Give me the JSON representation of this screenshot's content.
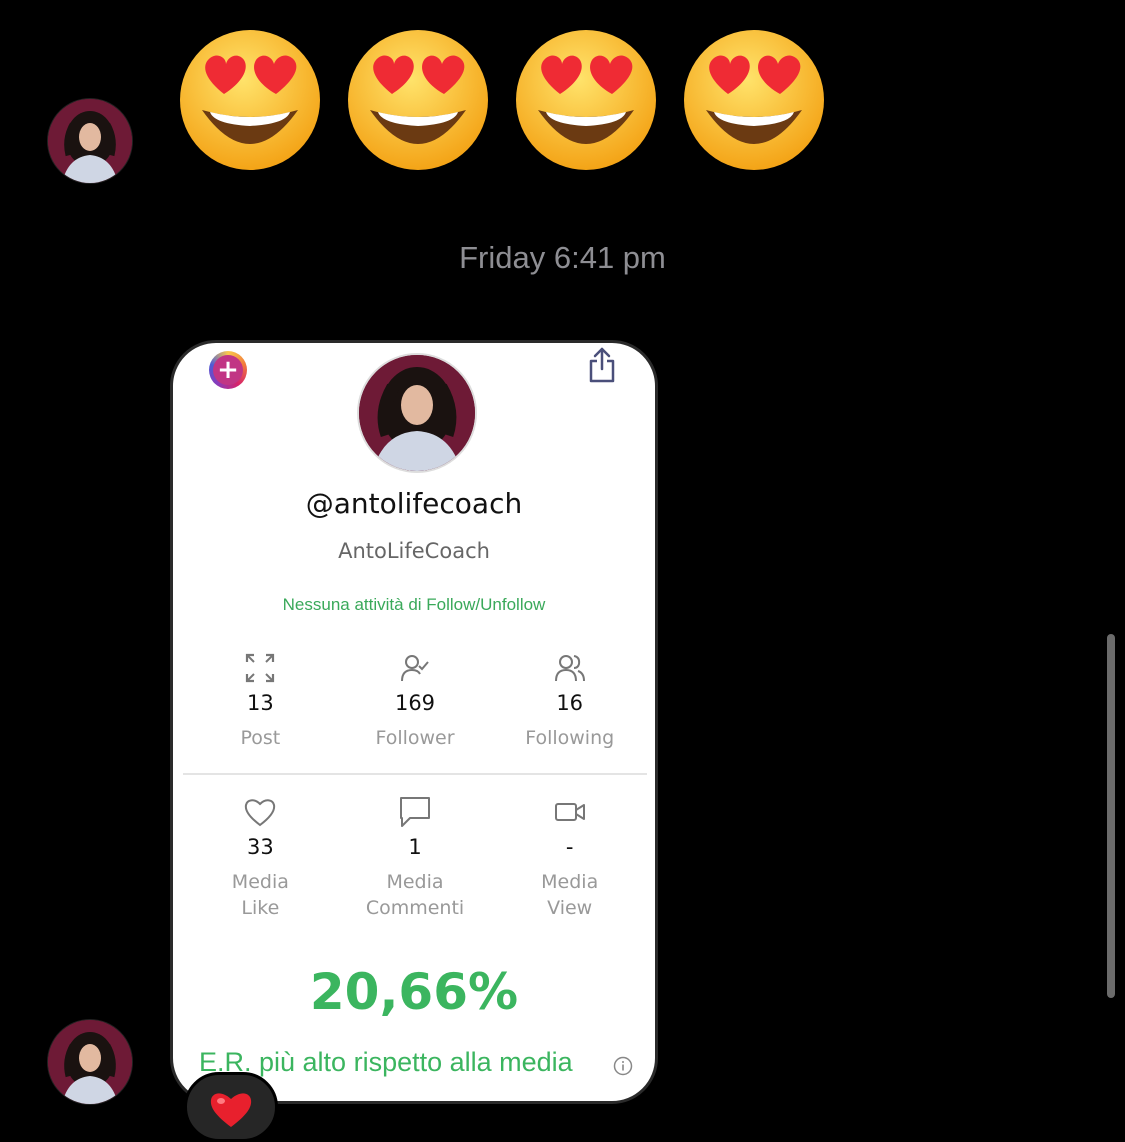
{
  "chat": {
    "timestamp": "Friday 6:41 pm",
    "emoji_count": 4,
    "reaction": "heart"
  },
  "profile_card": {
    "handle": "@antolifecoach",
    "display_name": "AntoLifeCoach",
    "follow_note": "Nessuna attività di Follow/Unfollow",
    "stats": [
      {
        "icon": "expand-icon",
        "value": "13",
        "label": "Post"
      },
      {
        "icon": "user-check-icon",
        "value": "169",
        "label": "Follower"
      },
      {
        "icon": "users-icon",
        "value": "16",
        "label": "Following"
      }
    ],
    "media": [
      {
        "icon": "heart-outline-icon",
        "value": "33",
        "label_line1": "Media",
        "label_line2": "Like"
      },
      {
        "icon": "comment-icon",
        "value": "1",
        "label_line1": "Media",
        "label_line2": "Commenti"
      },
      {
        "icon": "video-icon",
        "value": "-",
        "label_line1": "Media",
        "label_line2": "View"
      }
    ],
    "engagement_rate": "20,66%",
    "er_note": "E.R. più alto rispetto alla media"
  },
  "colors": {
    "accent_green": "#3bb55f",
    "background": "#000000",
    "card": "#ffffff"
  }
}
